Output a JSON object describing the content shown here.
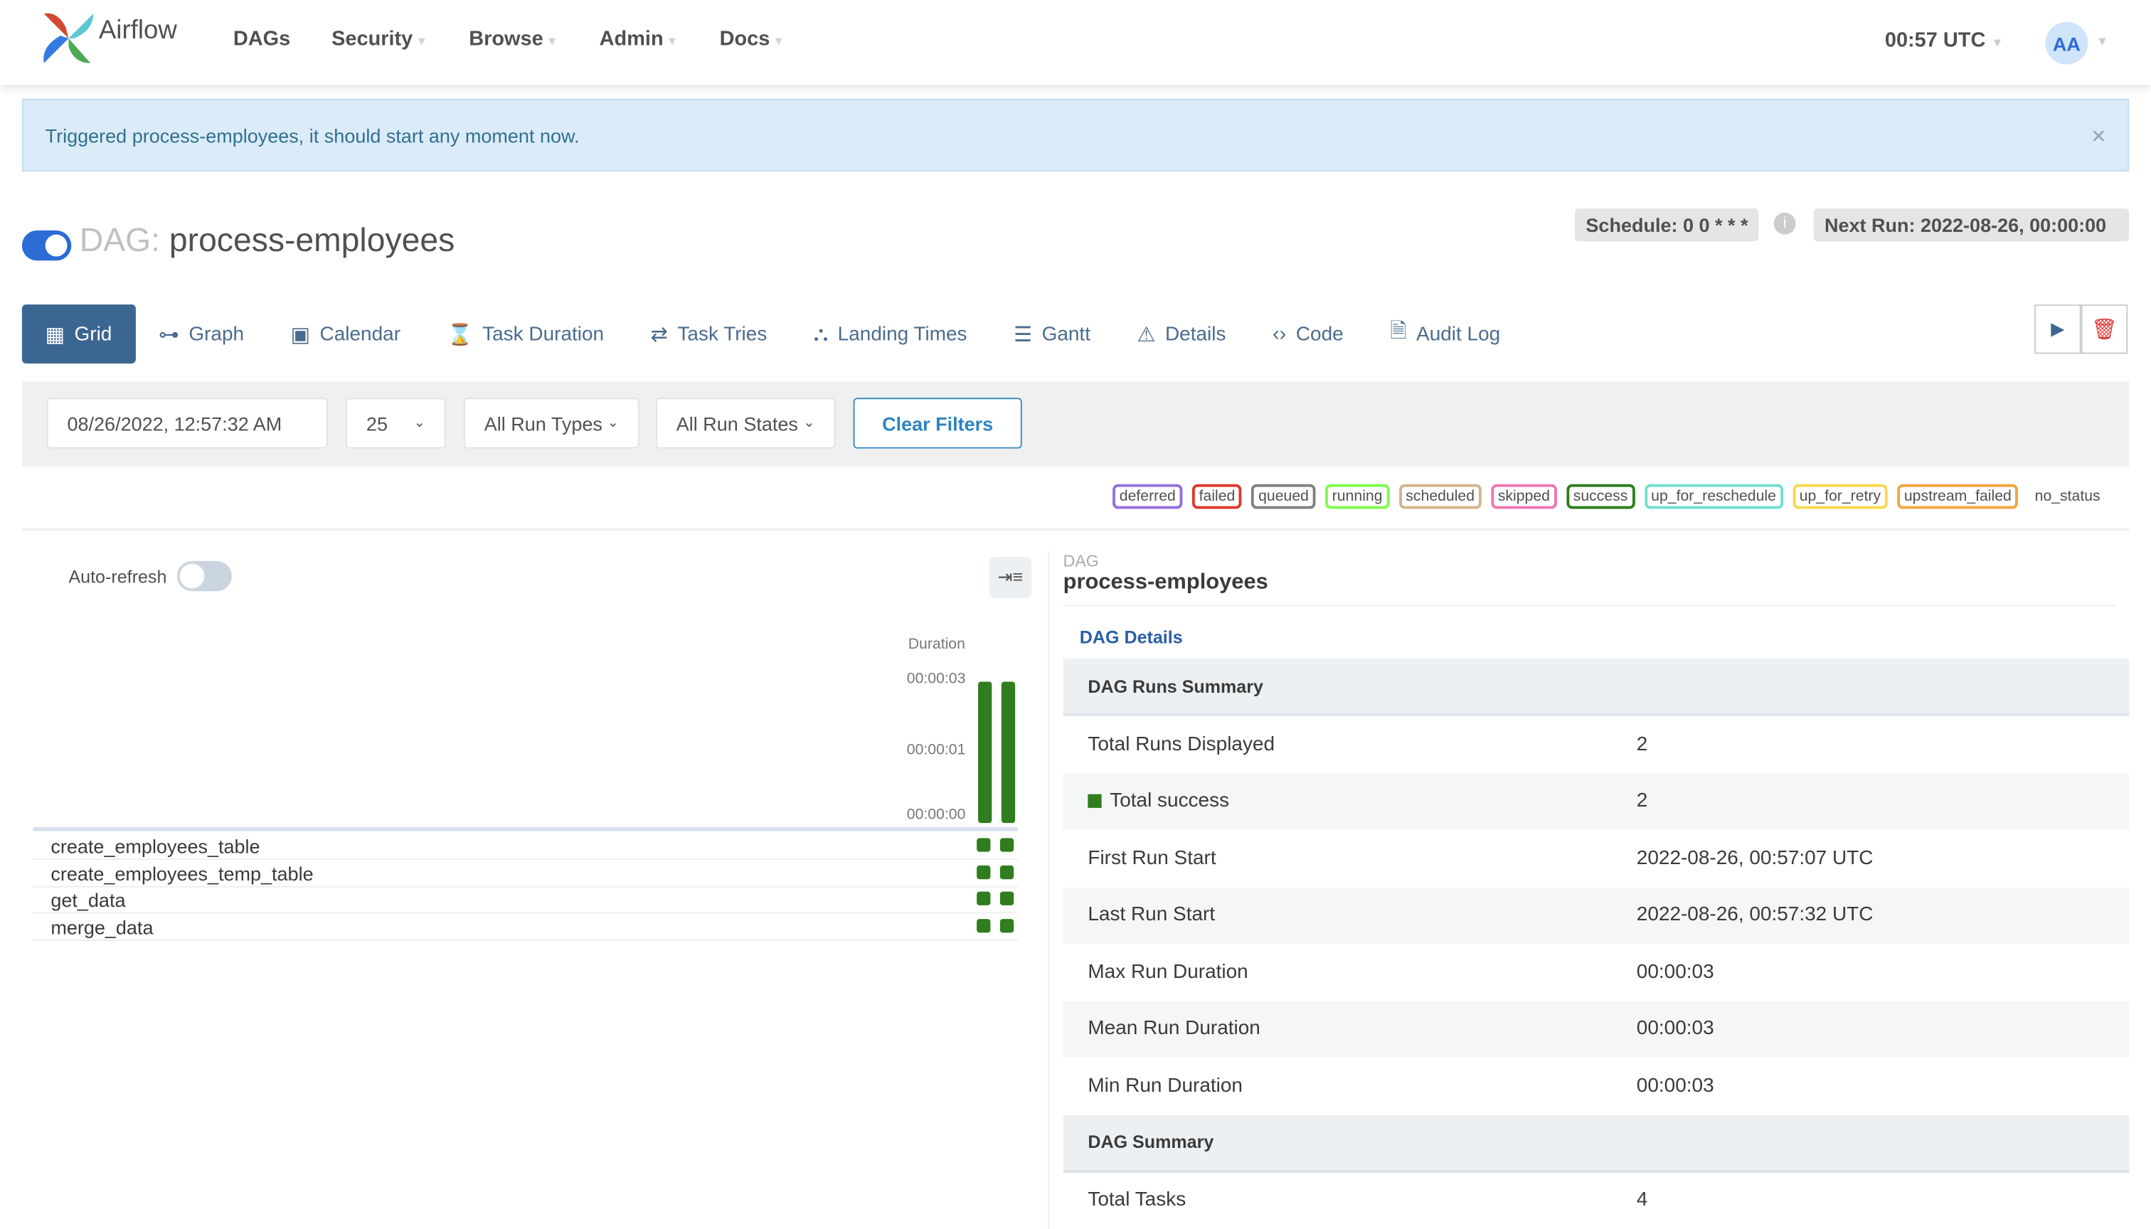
{
  "nav": {
    "brand": "Airflow",
    "items": [
      {
        "label": "DAGs",
        "dropdown": false
      },
      {
        "label": "Security",
        "dropdown": true
      },
      {
        "label": "Browse",
        "dropdown": true
      },
      {
        "label": "Admin",
        "dropdown": true
      },
      {
        "label": "Docs",
        "dropdown": true
      }
    ],
    "clock": "00:57 UTC",
    "avatar": "AA"
  },
  "alert": {
    "message": "Triggered process-employees, it should start any moment now.",
    "close": "×"
  },
  "dag": {
    "prefix": "DAG:",
    "name": "process-employees",
    "paused": false,
    "schedule": "Schedule: 0 0 * * *",
    "next_run": "Next Run: 2022-08-26, 00:00:00"
  },
  "tabs": [
    {
      "label": "Grid",
      "icon": "grid-icon",
      "active": true
    },
    {
      "label": "Graph",
      "icon": "graph-icon"
    },
    {
      "label": "Calendar",
      "icon": "calendar-icon"
    },
    {
      "label": "Task Duration",
      "icon": "hourglass-icon"
    },
    {
      "label": "Task Tries",
      "icon": "repeat-icon"
    },
    {
      "label": "Landing Times",
      "icon": "landing-icon"
    },
    {
      "label": "Gantt",
      "icon": "gantt-icon"
    },
    {
      "label": "Details",
      "icon": "warning-icon"
    },
    {
      "label": "Code",
      "icon": "code-icon"
    },
    {
      "label": "Audit Log",
      "icon": "file-search-icon"
    }
  ],
  "filters": {
    "date": "08/26/2022, 12:57:32 AM",
    "count": "25",
    "run_types": "All Run Types",
    "run_states": "All Run States",
    "clear": "Clear Filters"
  },
  "legend": [
    {
      "label": "deferred",
      "color": "#9370db"
    },
    {
      "label": "failed",
      "color": "#e0392b"
    },
    {
      "label": "queued",
      "color": "#808080"
    },
    {
      "label": "running",
      "color": "#7cfc4a"
    },
    {
      "label": "scheduled",
      "color": "#d2b48c"
    },
    {
      "label": "skipped",
      "color": "#f075b0"
    },
    {
      "label": "success",
      "color": "#2f7d1e"
    },
    {
      "label": "up_for_reschedule",
      "color": "#6fdfd0"
    },
    {
      "label": "up_for_retry",
      "color": "#f8d84a"
    },
    {
      "label": "upstream_failed",
      "color": "#f0a540"
    },
    {
      "label": "no_status",
      "color": ""
    }
  ],
  "grid": {
    "auto_refresh": "Auto-refresh",
    "auto_refresh_on": false,
    "duration_label": "Duration",
    "ticks": [
      "00:00:03",
      "00:00:01",
      "00:00:00"
    ],
    "runs": [
      {
        "duration_s": 3,
        "state": "success"
      },
      {
        "duration_s": 3,
        "state": "success"
      }
    ],
    "tasks": [
      "create_employees_table",
      "create_employees_temp_table",
      "get_data",
      "merge_data"
    ]
  },
  "details": {
    "header": "DAG",
    "name": "process-employees",
    "link": "DAG Details",
    "runs_summary_title": "DAG Runs Summary",
    "rows": [
      {
        "k": "Total Runs Displayed",
        "v": "2"
      },
      {
        "k": "Total success",
        "v": "2"
      },
      {
        "k": "First Run Start",
        "v": "2022-08-26, 00:57:07 UTC"
      },
      {
        "k": "Last Run Start",
        "v": "2022-08-26, 00:57:32 UTC"
      },
      {
        "k": "Max Run Duration",
        "v": "00:00:03"
      },
      {
        "k": "Mean Run Duration",
        "v": "00:00:03"
      },
      {
        "k": "Min Run Duration",
        "v": "00:00:03"
      }
    ],
    "dag_summary_title": "DAG Summary",
    "summary_rows": [
      {
        "k": "Total Tasks",
        "v": "4"
      }
    ]
  }
}
